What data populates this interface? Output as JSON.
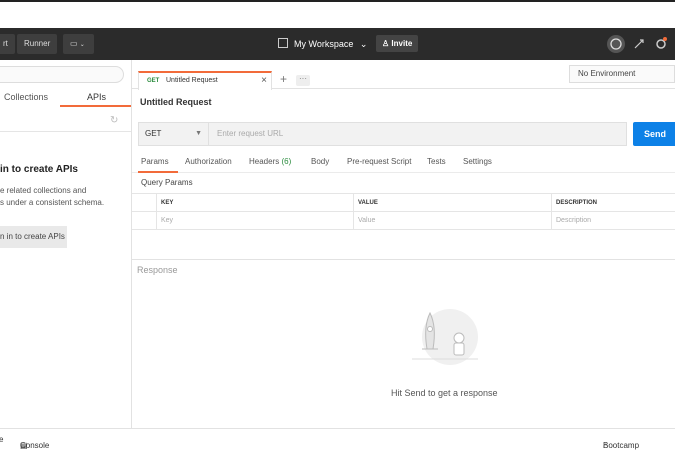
{
  "window": {
    "title_fragment": ""
  },
  "topbar": {
    "import_fragment": "rt",
    "runner_label": "Runner",
    "workspace_label": "My Workspace",
    "invite_label": "Invite"
  },
  "sidebar": {
    "tabs": [
      "Collections",
      "APIs"
    ],
    "active_tab": "APIs",
    "empty_heading": "in to create APIs",
    "empty_text_line1": "e related collections and",
    "empty_text_line2": "s under a consistent schema.",
    "signin_button": "n in to create APIs"
  },
  "request_tab": {
    "method": "GET",
    "name": "Untitled Request"
  },
  "environment": {
    "selected": "No Environment"
  },
  "request": {
    "title": "Untitled Request",
    "method": "GET",
    "url_placeholder": "Enter request URL",
    "send_label": "Send"
  },
  "request_tabs": {
    "params": "Params",
    "authorization": "Authorization",
    "headers": "Headers",
    "headers_count": "(6)",
    "body": "Body",
    "prerequest": "Pre-request Script",
    "tests": "Tests",
    "settings": "Settings"
  },
  "query_params": {
    "title": "Query Params",
    "columns": [
      "KEY",
      "VALUE",
      "DESCRIPTION"
    ],
    "placeholders": [
      "Key",
      "Value",
      "Description"
    ]
  },
  "response": {
    "label": "Response",
    "hint": "Hit Send to get a response"
  },
  "footer": {
    "left_fragment": "e",
    "console_label": "Console",
    "bootcamp_label": "Bootcamp"
  },
  "colors": {
    "accent": "#f26b3a",
    "send": "#0d81e7",
    "topbar": "#2b2b2b",
    "get_method": "#2a8b3d"
  }
}
